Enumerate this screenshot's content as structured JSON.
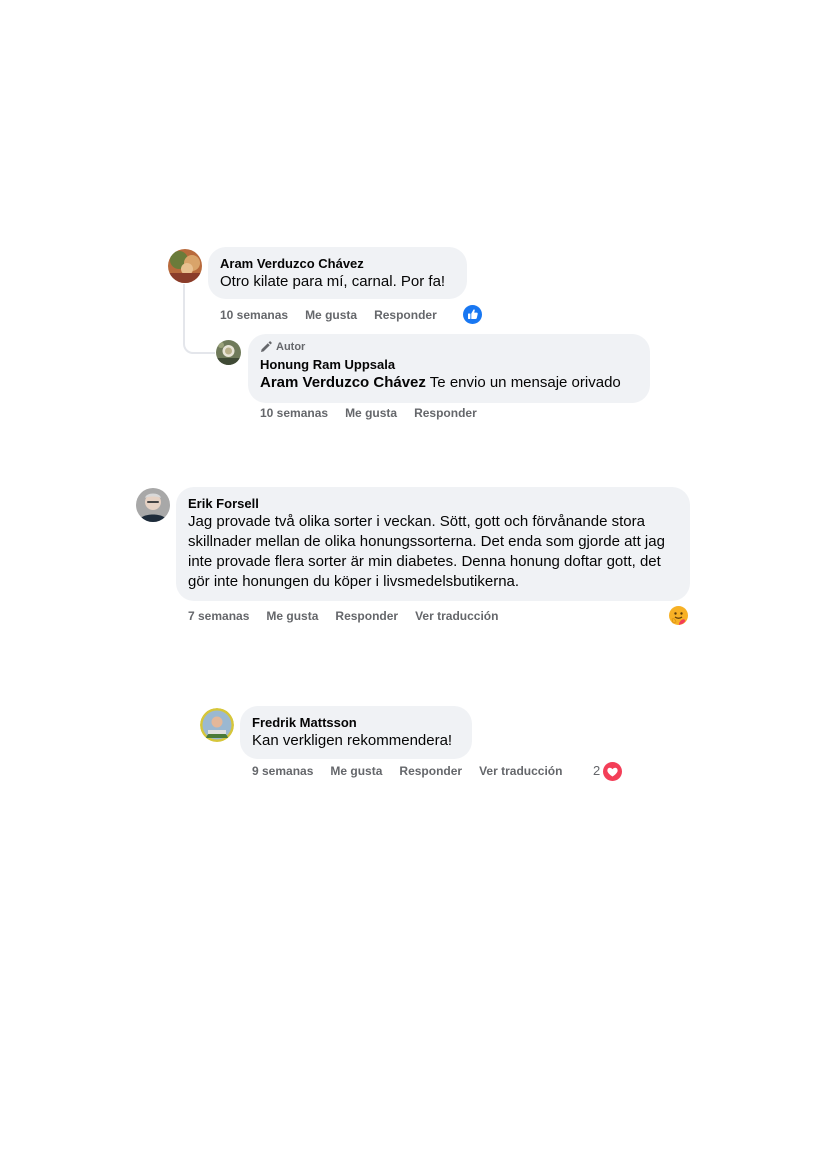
{
  "comments": [
    {
      "author": "Aram Verduzco Chávez",
      "text": "Otro kilate para mí, carnal. Por fa!",
      "time": "10 semanas",
      "like": "Me gusta",
      "reply": "Responder",
      "reaction": "like-icon",
      "replies": [
        {
          "badge": "Autor",
          "author": "Honung Ram Uppsala",
          "tag": "Aram Verduzco Chávez",
          "text": " Te envio un mensaje orivado",
          "time": "10 semanas",
          "like": "Me gusta",
          "reply": "Responder"
        }
      ]
    },
    {
      "author": "Erik Forsell",
      "text": "Jag provade två olika sorter i veckan. Sött, gott och förvånande stora skillnader mellan de olika honungssorterna. Det enda som gjorde att jag inte provade flera sorter är min diabetes. Denna honung doftar gott, det gör inte honungen du köper i livsmedelsbutikerna.",
      "time": "7 semanas",
      "like": "Me gusta",
      "reply": "Responder",
      "translate": "Ver traducción",
      "reaction": "care-icon"
    },
    {
      "author": "Fredrik Mattsson",
      "text": "Kan verkligen rekommendera!",
      "time": "9 semanas",
      "like": "Me gusta",
      "reply": "Responder",
      "translate": "Ver traducción",
      "reaction_count": "2",
      "reaction": "love-icon"
    }
  ],
  "colors": {
    "bubble": "#f0f2f5",
    "action_text": "#65676b",
    "like_blue": "#1877f2",
    "love_red": "#f33e58",
    "care_yellow": "#f7b125"
  }
}
